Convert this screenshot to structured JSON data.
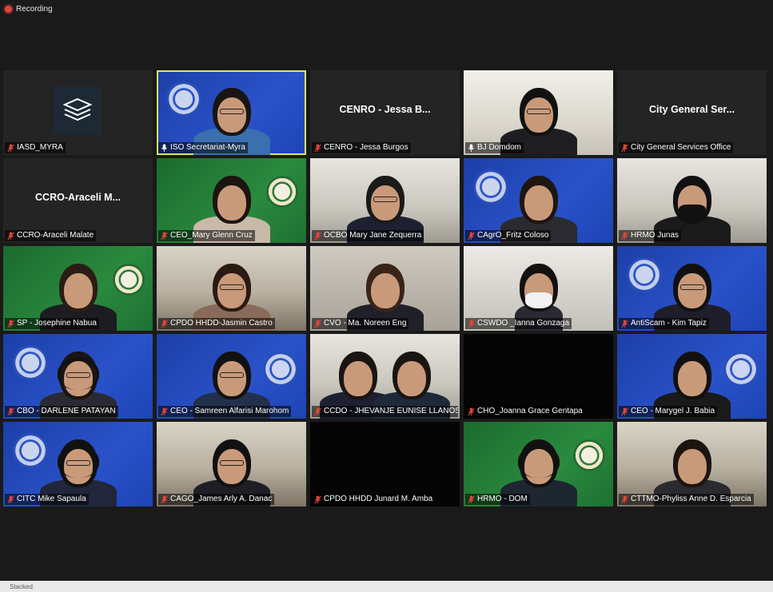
{
  "recording": {
    "label": "Recording"
  },
  "taskbar": {
    "text": "Stacked"
  },
  "colors": {
    "active_speaker": "#d9e86a",
    "mic_muted": "#e0453a",
    "recording": "#e0453a"
  },
  "participants": [
    {
      "name": "IASD_MYRA",
      "type": "logo",
      "bg": "dark",
      "icon": "stacked-layers-icon",
      "muted": true
    },
    {
      "name": "ISO Secretariat-Myra",
      "type": "video",
      "bg": "blue",
      "seal": "left",
      "active": true,
      "muted": false,
      "hair": "#1a1512",
      "shirt": "#3a6fb0",
      "glasses": true
    },
    {
      "name": "CENRO  - Jessa Burgos",
      "type": "avatar",
      "bg": "dark",
      "display": "CENRO  - Jessa B...",
      "muted": true
    },
    {
      "name": "BJ Domdom",
      "type": "video",
      "bg": "bright",
      "muted": false,
      "hair": "#111",
      "shirt": "#1e1e22",
      "glasses": true
    },
    {
      "name": "City General Services Office",
      "type": "avatar",
      "bg": "dark",
      "display": "City General Ser...",
      "muted": true
    },
    {
      "name": "CCRO-Araceli Malate",
      "type": "avatar",
      "bg": "dark",
      "display": "CCRO-Araceli M...",
      "muted": true
    },
    {
      "name": "CEO_Mary Glenn Cruz",
      "type": "video",
      "bg": "green",
      "seal": "right-green",
      "muted": true,
      "hair": "#1c1410",
      "shirt": "#c9b9a8"
    },
    {
      "name": "OCBO Mary Jane Zequerra",
      "type": "video",
      "bg": "office",
      "muted": true,
      "hair": "#1a1a1a",
      "shirt": "#1c2030",
      "glasses": true
    },
    {
      "name": "CAgrO_Fritz Coloso",
      "type": "video",
      "bg": "blue",
      "seal": "left",
      "muted": true,
      "hair": "#1e1612",
      "shirt": "#2a2a30"
    },
    {
      "name": "HRMO Junas",
      "type": "video",
      "bg": "office",
      "muted": true,
      "hair": "#111",
      "shirt": "#1a1a1a",
      "mask": "#111"
    },
    {
      "name": "SP - Josephine Nabua",
      "type": "video",
      "bg": "green",
      "seal": "right-green",
      "muted": true,
      "hair": "#2a1d15",
      "shirt": "#1c1c22"
    },
    {
      "name": "CPDO HHDD-Jasmin Castro",
      "type": "video",
      "bg": "room",
      "muted": true,
      "hair": "#2b1a12",
      "shirt": "#8a6a58",
      "glasses": true
    },
    {
      "name": "CVO - Ma. Noreen Eng",
      "type": "video",
      "bg": "wall",
      "muted": true,
      "hair": "#3a2418",
      "shirt": "#202028"
    },
    {
      "name": "CSWDO _Ianna Gonzaga",
      "type": "video",
      "bg": "studio",
      "muted": true,
      "hair": "#141010",
      "shirt": "#2a2a35",
      "mask": "#f2f2f2",
      "narrow": true
    },
    {
      "name": "AntiScam - Kim Tapiz",
      "type": "video",
      "bg": "blue",
      "seal": "left",
      "muted": true,
      "hair": "#111",
      "shirt": "#1e1e2a",
      "glasses": true
    },
    {
      "name": "CBO - DARLENE PATAYAN",
      "type": "video",
      "bg": "blue",
      "seal": "left",
      "muted": true,
      "hair": "#1a1512",
      "shirt": "#2a2a32",
      "glasses": true,
      "headset": true
    },
    {
      "name": "CEO - Samreen Alfarisi Marohom",
      "type": "video",
      "bg": "blue",
      "seal": "right",
      "muted": true,
      "hair": "#111",
      "shirt": "#23304d",
      "glasses": true
    },
    {
      "name": "CCDO - JHEVANJE EUNISE LLANOS",
      "type": "video",
      "bg": "office",
      "muted": true,
      "hair": "#1a1512",
      "shirt": "#1c2030",
      "pair": true
    },
    {
      "name": "CHO_Joanna Grace Gentapa",
      "type": "empty",
      "bg": "black",
      "muted": true
    },
    {
      "name": "CEO - Marygel J. Babia",
      "type": "video",
      "bg": "blue",
      "seal": "right",
      "muted": true,
      "hair": "#131010",
      "shirt": "#1a1a1a"
    },
    {
      "name": "CITC Mike Sapaula",
      "type": "video",
      "bg": "blue",
      "seal": "left",
      "muted": true,
      "hair": "#111",
      "shirt": "#22263a",
      "glasses": true,
      "headset": true
    },
    {
      "name": "CAGO_James Arly A. Danac",
      "type": "video",
      "bg": "room",
      "muted": true,
      "hair": "#111",
      "shirt": "#1e1e24",
      "glasses": true
    },
    {
      "name": "CPDO HHDD Junard M. Amba",
      "type": "empty",
      "bg": "black",
      "muted": true
    },
    {
      "name": "HRMO - DOM",
      "type": "video",
      "bg": "green",
      "seal": "right-green",
      "muted": true,
      "hair": "#111",
      "shirt": "#1e2630",
      "headset": true
    },
    {
      "name": "CTTMO-Phyliss Anne D. Esparcia",
      "type": "video",
      "bg": "room",
      "muted": true,
      "hair": "#1c1410",
      "shirt": "#2a2a30"
    }
  ]
}
